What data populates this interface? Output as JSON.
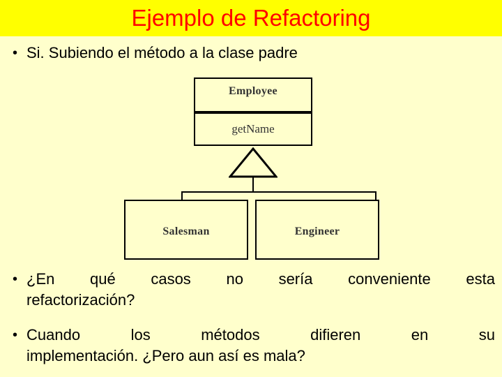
{
  "slide": {
    "background_color": "#ffffcc",
    "title_band_color": "#ffff00",
    "title": "Ejemplo de Refactoring",
    "title_color": "#ff0000"
  },
  "bullets": [
    {
      "marker": "•",
      "text": "Si. Subiendo el método a la clase padre"
    },
    {
      "marker": "•",
      "line1": "¿En qué casos no sería conveniente esta",
      "line2": "refactorización?"
    },
    {
      "marker": "•",
      "line1": "Cuando los métodos difieren en su",
      "line2": "implementación. ¿Pero aun así es mala?"
    }
  ],
  "diagram": {
    "type": "uml-class-diagram",
    "parent": {
      "name": "Employee",
      "member": "getName"
    },
    "children": [
      {
        "name": "Salesman"
      },
      {
        "name": "Engineer"
      }
    ],
    "relation": "generalization"
  }
}
